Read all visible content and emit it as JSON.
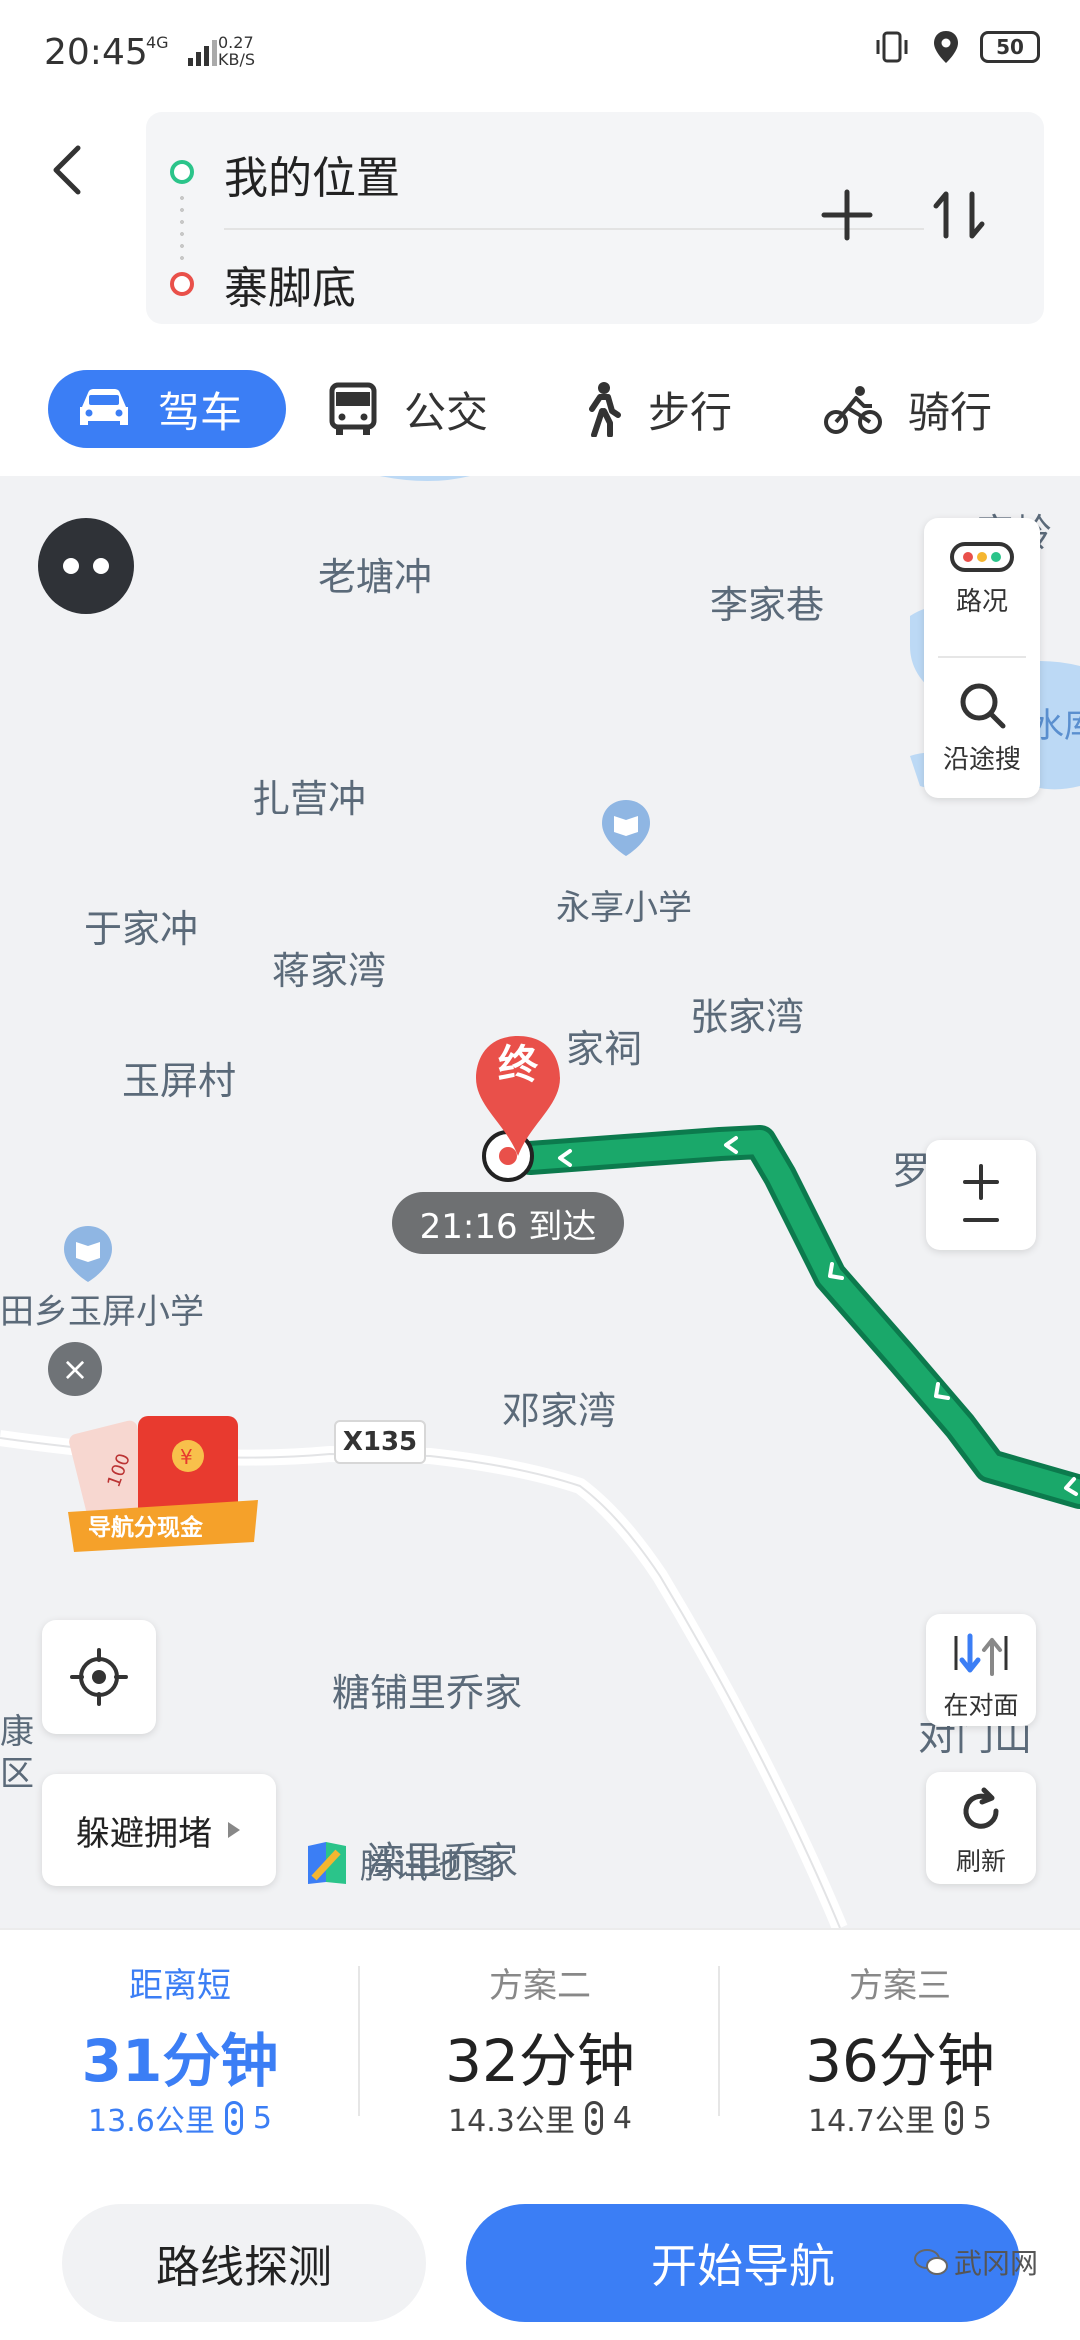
{
  "status_bar": {
    "time": "20:45",
    "network": "4G",
    "speed_value": "0.27",
    "speed_unit": "KB/S",
    "battery": "50"
  },
  "route": {
    "start": "我的位置",
    "end": "寨脚底"
  },
  "tabs": [
    {
      "label": "驾车",
      "icon": "car-icon",
      "active": true
    },
    {
      "label": "公交",
      "icon": "bus-icon",
      "active": false
    },
    {
      "label": "步行",
      "icon": "walk-icon",
      "active": false
    },
    {
      "label": "骑行",
      "icon": "bike-icon",
      "active": false
    }
  ],
  "map": {
    "places": {
      "laotangchong": "老塘冲",
      "lijiaxiang": "李家巷",
      "zhayingchong": "扎营冲",
      "yongxiang_school": "永享小学",
      "yujiachong": "于家冲",
      "jiangjiawan": "蒋家湾",
      "zhangjiawan": "张家湾",
      "jiaci": "家祠",
      "yupingcun": "玉屏村",
      "yuping_school": "田乡玉屏小学",
      "dengjiawan": "邓家湾",
      "tangpuli": "糖铺里乔家",
      "luo": "罗",
      "top_right": "家岭",
      "reservoir": "水库",
      "left_edge_1": "康",
      "left_edge_2": "区",
      "duimenshan": "对门山",
      "bottom_place": "滦里乔家"
    },
    "road_label": "X135",
    "end_marker": "终",
    "eta": "21:16 到达",
    "brand": "腾讯地图",
    "ad_text": "导航分现金",
    "ad_amount": "100",
    "tools": {
      "traffic": "路况",
      "along_search": "沿途搜",
      "opposite": "在对面",
      "refresh": "刷新",
      "avoid": "躲避拥堵"
    },
    "colors": {
      "route": "#1aa86a",
      "accent": "#3b7ef5"
    }
  },
  "plans": [
    {
      "tag": "距离短",
      "time": "31分钟",
      "distance": "13.6公里",
      "lights": "5",
      "selected": true
    },
    {
      "tag": "方案二",
      "time": "32分钟",
      "distance": "14.3公里",
      "lights": "4",
      "selected": false
    },
    {
      "tag": "方案三",
      "time": "36分钟",
      "distance": "14.7公里",
      "lights": "5",
      "selected": false
    }
  ],
  "actions": {
    "probe": "路线探测",
    "start_nav": "开始导航"
  },
  "watermark": "武冈网"
}
